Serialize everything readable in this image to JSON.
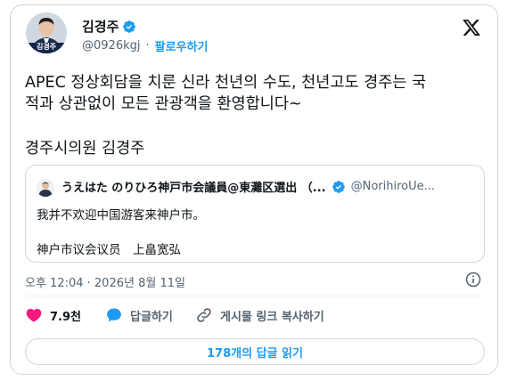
{
  "author": {
    "name": "김경주",
    "handle": "@0926kgj",
    "separator": "·",
    "follow_label": "팔로우하기",
    "avatar_badge": "김경주"
  },
  "tweet": {
    "lines": [
      "APEC 정상회담을 치룬 신라 천년의 수도, 천년고도 경주는 국",
      "적과 상관없이 모든 관광객을 환영합니다~"
    ],
    "signature": "경주시의원 김경주"
  },
  "quote": {
    "name": "うえはた のりひろ神戸市会議員@東灘区選出 （...",
    "handle": "@NorihiroUe...",
    "text": "我并不欢迎中国游客来神户市。",
    "signature": "神户市议会议员　上畠宽弘"
  },
  "timestamp": "오후 12:04 · 2026년 8월 11일",
  "actions": {
    "likes": "7.9천",
    "reply": "답글하기",
    "copy_link": "게시물 링크 복사하기"
  },
  "replies_button": "178개의 답글 읽기",
  "colors": {
    "accent": "#1d9bf0",
    "like": "#f91880",
    "text_secondary": "#536471",
    "border": "#cfd9de"
  }
}
